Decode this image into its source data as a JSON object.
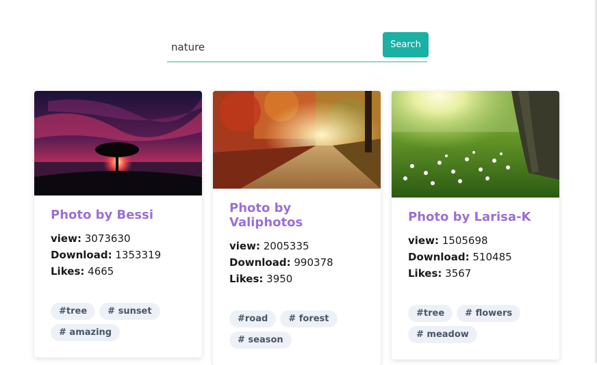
{
  "search": {
    "value": "nature",
    "button_label": "Search"
  },
  "cards": [
    {
      "title": "Photo by Bessi",
      "view_label": "view:",
      "view": "3073630",
      "download_label": "Download:",
      "download": "1353319",
      "likes_label": "Likes:",
      "likes": "4665",
      "tags": [
        "#tree",
        "# sunset",
        "# amazing"
      ]
    },
    {
      "title": "Photo by Valiphotos",
      "view_label": "view:",
      "view": "2005335",
      "download_label": "Download:",
      "download": "990378",
      "likes_label": "Likes:",
      "likes": "3950",
      "tags": [
        "#road",
        "# forest",
        "# season"
      ]
    },
    {
      "title": "Photo by Larisa-K",
      "view_label": "view:",
      "view": "1505698",
      "download_label": "Download:",
      "download": "510485",
      "likes_label": "Likes:",
      "likes": "3567",
      "tags": [
        "#tree",
        "# flowers",
        "# meadow"
      ]
    }
  ],
  "colors": {
    "accent": "#1ab1a4",
    "title": "#9b6fd6",
    "tag_bg": "#edf1f7"
  }
}
